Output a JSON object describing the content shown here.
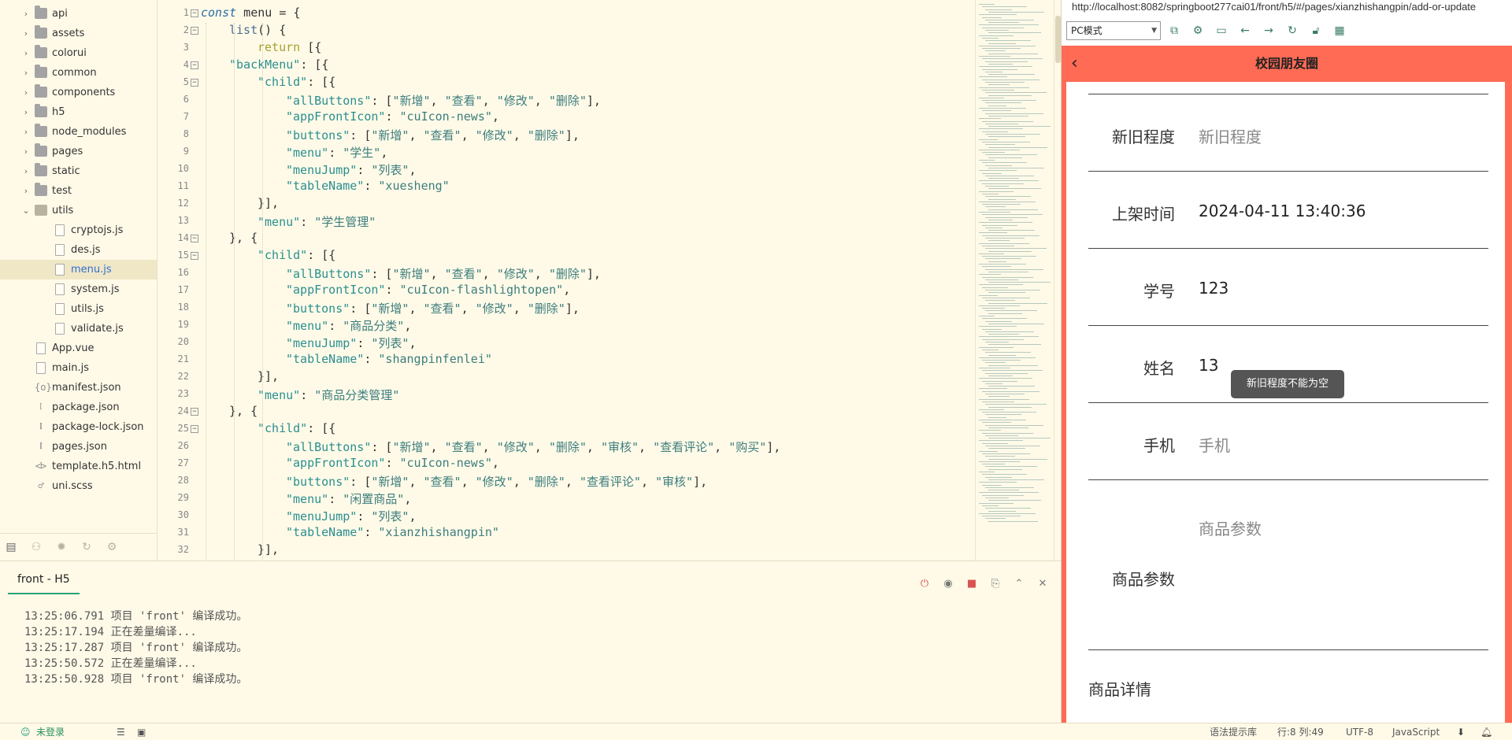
{
  "sidebar": {
    "items": [
      {
        "label": "api",
        "type": "folder"
      },
      {
        "label": "assets",
        "type": "folder"
      },
      {
        "label": "colorui",
        "type": "folder"
      },
      {
        "label": "common",
        "type": "folder"
      },
      {
        "label": "components",
        "type": "folder"
      },
      {
        "label": "h5",
        "type": "folder"
      },
      {
        "label": "node_modules",
        "type": "folder"
      },
      {
        "label": "pages",
        "type": "folder"
      },
      {
        "label": "static",
        "type": "folder"
      },
      {
        "label": "test",
        "type": "folder"
      },
      {
        "label": "utils",
        "type": "folder-open"
      },
      {
        "label": "cryptojs.js",
        "type": "file"
      },
      {
        "label": "des.js",
        "type": "file"
      },
      {
        "label": "menu.js",
        "type": "file",
        "selected": true
      },
      {
        "label": "system.js",
        "type": "file"
      },
      {
        "label": "utils.js",
        "type": "file"
      },
      {
        "label": "validate.js",
        "type": "file"
      },
      {
        "label": "App.vue",
        "type": "file"
      },
      {
        "label": "main.js",
        "type": "file"
      },
      {
        "label": "manifest.json",
        "type": "json-settings"
      },
      {
        "label": "package.json",
        "type": "json"
      },
      {
        "label": "package-lock.json",
        "type": "json"
      },
      {
        "label": "pages.json",
        "type": "json"
      },
      {
        "label": "template.h5.html",
        "type": "html"
      },
      {
        "label": "uni.scss",
        "type": "scss"
      }
    ]
  },
  "editor": {
    "lines": [
      {
        "n": "1",
        "fold": "⊟",
        "indent": 0,
        "tokens": [
          [
            "kw",
            "const"
          ],
          [
            "pun",
            " menu = {"
          ]
        ]
      },
      {
        "n": "2",
        "fold": "⊟",
        "indent": 1,
        "tokens": [
          [
            "fn",
            "list"
          ],
          [
            "pun",
            "() {"
          ]
        ]
      },
      {
        "n": "3",
        "fold": "",
        "indent": 2,
        "tokens": [
          [
            "kw2",
            "return"
          ],
          [
            "pun",
            " [{"
          ]
        ]
      },
      {
        "n": "4",
        "fold": "⊟",
        "indent": 1,
        "tokens": [
          [
            "key",
            "\"backMenu\""
          ],
          [
            "pun",
            ": [{"
          ]
        ]
      },
      {
        "n": "5",
        "fold": "⊟",
        "indent": 2,
        "tokens": [
          [
            "key",
            "\"child\""
          ],
          [
            "pun",
            ": [{"
          ]
        ]
      },
      {
        "n": "6",
        "fold": "",
        "indent": 3,
        "tokens": [
          [
            "key",
            "\"allButtons\""
          ],
          [
            "pun",
            ": ["
          ],
          [
            "str",
            "\"新增\""
          ],
          [
            "pun",
            ", "
          ],
          [
            "str",
            "\"查看\""
          ],
          [
            "pun",
            ", "
          ],
          [
            "str",
            "\"修改\""
          ],
          [
            "pun",
            ", "
          ],
          [
            "str",
            "\"删除\""
          ],
          [
            "pun",
            "],"
          ]
        ]
      },
      {
        "n": "7",
        "fold": "",
        "indent": 3,
        "tokens": [
          [
            "key",
            "\"appFrontIcon\""
          ],
          [
            "pun",
            ": "
          ],
          [
            "str",
            "\"cuIcon-news\""
          ],
          [
            "pun",
            ","
          ]
        ]
      },
      {
        "n": "8",
        "fold": "",
        "indent": 3,
        "tokens": [
          [
            "key",
            "\"buttons\""
          ],
          [
            "pun",
            ": ["
          ],
          [
            "str",
            "\"新增\""
          ],
          [
            "pun",
            ", "
          ],
          [
            "str",
            "\"查看\""
          ],
          [
            "pun",
            ", "
          ],
          [
            "str",
            "\"修改\""
          ],
          [
            "pun",
            ", "
          ],
          [
            "str",
            "\"删除\""
          ],
          [
            "pun",
            "],"
          ]
        ]
      },
      {
        "n": "9",
        "fold": "",
        "indent": 3,
        "tokens": [
          [
            "key",
            "\"menu\""
          ],
          [
            "pun",
            ": "
          ],
          [
            "str",
            "\"学生\""
          ],
          [
            "pun",
            ","
          ]
        ]
      },
      {
        "n": "10",
        "fold": "",
        "indent": 3,
        "tokens": [
          [
            "key",
            "\"menuJump\""
          ],
          [
            "pun",
            ": "
          ],
          [
            "str",
            "\"列表\""
          ],
          [
            "pun",
            ","
          ]
        ]
      },
      {
        "n": "11",
        "fold": "",
        "indent": 3,
        "tokens": [
          [
            "key",
            "\"tableName\""
          ],
          [
            "pun",
            ": "
          ],
          [
            "str",
            "\"xuesheng\""
          ]
        ]
      },
      {
        "n": "12",
        "fold": "",
        "indent": 2,
        "tokens": [
          [
            "pun",
            "}],"
          ]
        ]
      },
      {
        "n": "13",
        "fold": "",
        "indent": 2,
        "tokens": [
          [
            "key",
            "\"menu\""
          ],
          [
            "pun",
            ": "
          ],
          [
            "str",
            "\"学生管理\""
          ]
        ]
      },
      {
        "n": "14",
        "fold": "⊟",
        "indent": 1,
        "tokens": [
          [
            "pun",
            "}, {"
          ]
        ]
      },
      {
        "n": "15",
        "fold": "⊟",
        "indent": 2,
        "tokens": [
          [
            "key",
            "\"child\""
          ],
          [
            "pun",
            ": [{"
          ]
        ]
      },
      {
        "n": "16",
        "fold": "",
        "indent": 3,
        "tokens": [
          [
            "key",
            "\"allButtons\""
          ],
          [
            "pun",
            ": ["
          ],
          [
            "str",
            "\"新增\""
          ],
          [
            "pun",
            ", "
          ],
          [
            "str",
            "\"查看\""
          ],
          [
            "pun",
            ", "
          ],
          [
            "str",
            "\"修改\""
          ],
          [
            "pun",
            ", "
          ],
          [
            "str",
            "\"删除\""
          ],
          [
            "pun",
            "],"
          ]
        ]
      },
      {
        "n": "17",
        "fold": "",
        "indent": 3,
        "tokens": [
          [
            "key",
            "\"appFrontIcon\""
          ],
          [
            "pun",
            ": "
          ],
          [
            "str",
            "\"cuIcon-flashlightopen\""
          ],
          [
            "pun",
            ","
          ]
        ]
      },
      {
        "n": "18",
        "fold": "",
        "indent": 3,
        "tokens": [
          [
            "key",
            "\"buttons\""
          ],
          [
            "pun",
            ": ["
          ],
          [
            "str",
            "\"新增\""
          ],
          [
            "pun",
            ", "
          ],
          [
            "str",
            "\"查看\""
          ],
          [
            "pun",
            ", "
          ],
          [
            "str",
            "\"修改\""
          ],
          [
            "pun",
            ", "
          ],
          [
            "str",
            "\"删除\""
          ],
          [
            "pun",
            "],"
          ]
        ]
      },
      {
        "n": "19",
        "fold": "",
        "indent": 3,
        "tokens": [
          [
            "key",
            "\"menu\""
          ],
          [
            "pun",
            ": "
          ],
          [
            "str",
            "\"商品分类\""
          ],
          [
            "pun",
            ","
          ]
        ]
      },
      {
        "n": "20",
        "fold": "",
        "indent": 3,
        "tokens": [
          [
            "key",
            "\"menuJump\""
          ],
          [
            "pun",
            ": "
          ],
          [
            "str",
            "\"列表\""
          ],
          [
            "pun",
            ","
          ]
        ]
      },
      {
        "n": "21",
        "fold": "",
        "indent": 3,
        "tokens": [
          [
            "key",
            "\"tableName\""
          ],
          [
            "pun",
            ": "
          ],
          [
            "str",
            "\"shangpinfenlei\""
          ]
        ]
      },
      {
        "n": "22",
        "fold": "",
        "indent": 2,
        "tokens": [
          [
            "pun",
            "}],"
          ]
        ]
      },
      {
        "n": "23",
        "fold": "",
        "indent": 2,
        "tokens": [
          [
            "key",
            "\"menu\""
          ],
          [
            "pun",
            ": "
          ],
          [
            "str",
            "\"商品分类管理\""
          ]
        ]
      },
      {
        "n": "24",
        "fold": "⊟",
        "indent": 1,
        "tokens": [
          [
            "pun",
            "}, {"
          ]
        ]
      },
      {
        "n": "25",
        "fold": "⊟",
        "indent": 2,
        "tokens": [
          [
            "key",
            "\"child\""
          ],
          [
            "pun",
            ": [{"
          ]
        ]
      },
      {
        "n": "26",
        "fold": "",
        "indent": 3,
        "tokens": [
          [
            "key",
            "\"allButtons\""
          ],
          [
            "pun",
            ": ["
          ],
          [
            "str",
            "\"新增\""
          ],
          [
            "pun",
            ", "
          ],
          [
            "str",
            "\"查看\""
          ],
          [
            "pun",
            ", "
          ],
          [
            "str",
            "\"修改\""
          ],
          [
            "pun",
            ", "
          ],
          [
            "str",
            "\"删除\""
          ],
          [
            "pun",
            ", "
          ],
          [
            "str",
            "\"审核\""
          ],
          [
            "pun",
            ", "
          ],
          [
            "str",
            "\"查看评论\""
          ],
          [
            "pun",
            ", "
          ],
          [
            "str",
            "\"购买\""
          ],
          [
            "pun",
            "],"
          ]
        ]
      },
      {
        "n": "27",
        "fold": "",
        "indent": 3,
        "tokens": [
          [
            "key",
            "\"appFrontIcon\""
          ],
          [
            "pun",
            ": "
          ],
          [
            "str",
            "\"cuIcon-news\""
          ],
          [
            "pun",
            ","
          ]
        ]
      },
      {
        "n": "28",
        "fold": "",
        "indent": 3,
        "tokens": [
          [
            "key",
            "\"buttons\""
          ],
          [
            "pun",
            ": ["
          ],
          [
            "str",
            "\"新增\""
          ],
          [
            "pun",
            ", "
          ],
          [
            "str",
            "\"查看\""
          ],
          [
            "pun",
            ", "
          ],
          [
            "str",
            "\"修改\""
          ],
          [
            "pun",
            ", "
          ],
          [
            "str",
            "\"删除\""
          ],
          [
            "pun",
            ", "
          ],
          [
            "str",
            "\"查看评论\""
          ],
          [
            "pun",
            ", "
          ],
          [
            "str",
            "\"审核\""
          ],
          [
            "pun",
            "],"
          ]
        ]
      },
      {
        "n": "29",
        "fold": "",
        "indent": 3,
        "tokens": [
          [
            "key",
            "\"menu\""
          ],
          [
            "pun",
            ": "
          ],
          [
            "str",
            "\"闲置商品\""
          ],
          [
            "pun",
            ","
          ]
        ]
      },
      {
        "n": "30",
        "fold": "",
        "indent": 3,
        "tokens": [
          [
            "key",
            "\"menuJump\""
          ],
          [
            "pun",
            ": "
          ],
          [
            "str",
            "\"列表\""
          ],
          [
            "pun",
            ","
          ]
        ]
      },
      {
        "n": "31",
        "fold": "",
        "indent": 3,
        "tokens": [
          [
            "key",
            "\"tableName\""
          ],
          [
            "pun",
            ": "
          ],
          [
            "str",
            "\"xianzhishangpin\""
          ]
        ]
      },
      {
        "n": "32",
        "fold": "",
        "indent": 2,
        "tokens": [
          [
            "pun",
            "}],"
          ]
        ]
      }
    ]
  },
  "console": {
    "tab_label": "front - H5",
    "lines": [
      "13:25:06.791 项目 'front' 编译成功。",
      "13:25:17.194 正在差量编译...",
      "13:25:17.287 项目 'front' 编译成功。",
      "13:25:50.572 正在差量编译...",
      "13:25:50.928 项目 'front' 编译成功。"
    ]
  },
  "statusbar": {
    "login": "未登录",
    "hint": "语法提示库",
    "position": "行:8  列:49",
    "encoding": "UTF-8",
    "language": "JavaScript"
  },
  "preview": {
    "url": "http://localhost:8082/springboot277cai01/front/h5/#/pages/xianzhishangpin/add-or-update",
    "mode": "PC模式",
    "nav_title": "校园朋友圈",
    "form": [
      {
        "label": "新旧程度",
        "value": "新旧程度",
        "placeholder": true
      },
      {
        "label": "上架时间",
        "value": "2024-04-11 13:40:36",
        "placeholder": false
      },
      {
        "label": "学号",
        "value": "123",
        "placeholder": false
      },
      {
        "label": "姓名",
        "value": "13",
        "placeholder": false
      },
      {
        "label": "手机",
        "value": "手机",
        "placeholder": true
      },
      {
        "label": "商品参数",
        "value": "商品参数",
        "placeholder": true
      }
    ],
    "detail_label": "商品详情",
    "toast": "新旧程度不能为空"
  }
}
